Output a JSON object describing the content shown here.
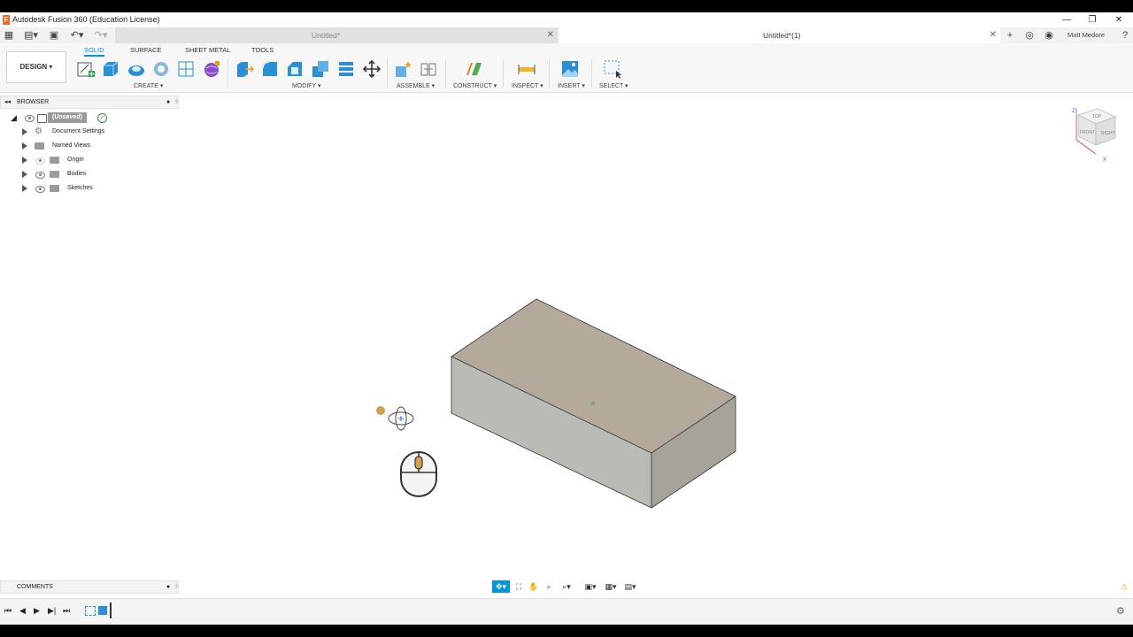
{
  "window": {
    "title": "Autodesk Fusion 360 (Education License)",
    "minimize": "—",
    "maximize": "❐",
    "close": "✕"
  },
  "tabs": {
    "inactive": {
      "label": "Untitled*",
      "close": "✕"
    },
    "active": {
      "label": "Untitled*(1)",
      "close": "✕"
    },
    "new_tab": "+",
    "user": "Matt Medore",
    "help": "?"
  },
  "ribbon": {
    "workspace": "DESIGN ▾",
    "tabs": [
      "SOLID",
      "SURFACE",
      "SHEET METAL",
      "TOOLS"
    ],
    "groups": {
      "create": "CREATE ▾",
      "modify": "MODIFY ▾",
      "assemble": "ASSEMBLE ▾",
      "construct": "CONSTRUCT ▾",
      "inspect": "INSPECT ▾",
      "insert": "INSERT ▾",
      "select": "SELECT ▾"
    }
  },
  "browser": {
    "title": "BROWSER",
    "root": "(Unsaved)",
    "items": [
      "Document Settings",
      "Named Views",
      "Origin",
      "Bodies",
      "Sketches"
    ]
  },
  "comments": {
    "title": "COMMENTS"
  },
  "viewcube": {
    "top": "TOP",
    "front": "FRONT",
    "right": "RIGHT",
    "z": "Z",
    "x": "X"
  },
  "colors": {
    "accent": "#0696d7",
    "box_top": "#b3aa9b",
    "box_front": "#bbbbb5",
    "box_side": "#a7a39a",
    "orbit_dot": "#d4a04a"
  }
}
